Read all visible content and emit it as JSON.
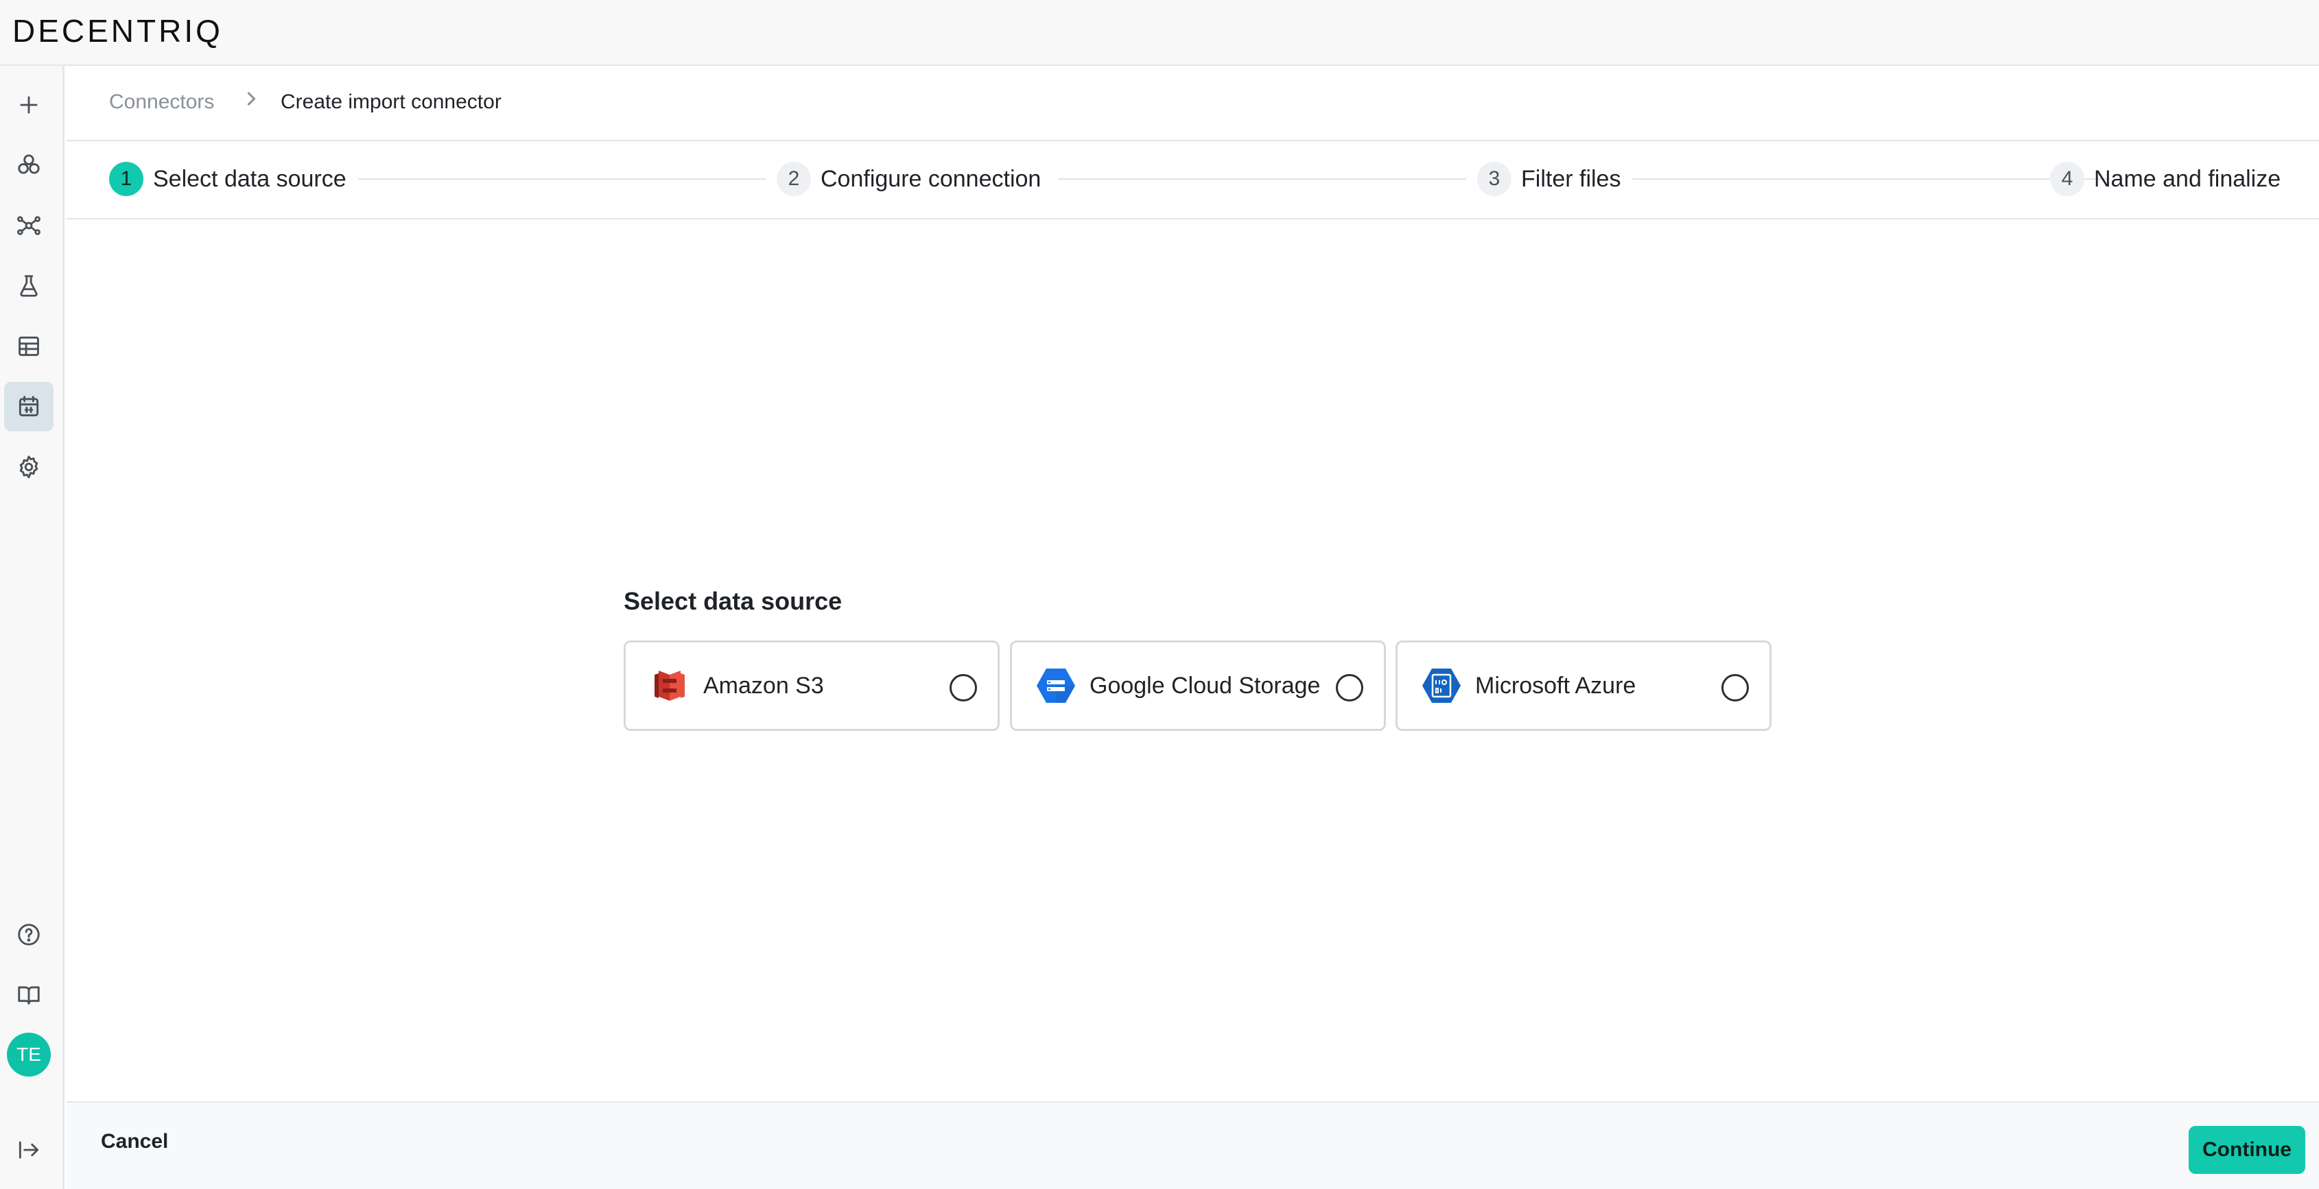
{
  "app": {
    "logo": "DECENTRIQ"
  },
  "sidebar": {
    "items": [
      {
        "name": "plus-icon"
      },
      {
        "name": "datarooms-icon"
      },
      {
        "name": "network-icon"
      },
      {
        "name": "flask-icon"
      },
      {
        "name": "table-icon"
      },
      {
        "name": "connector-icon",
        "active": true
      },
      {
        "name": "gear-icon"
      }
    ],
    "bottom": [
      {
        "name": "help-icon"
      },
      {
        "name": "book-icon"
      }
    ],
    "avatar_initials": "TE",
    "collapse_icon": "collapse-sidebar-icon"
  },
  "breadcrumb": {
    "root": "Connectors",
    "current": "Create import connector"
  },
  "stepper": {
    "steps": [
      {
        "number": "1",
        "label": "Select data source",
        "active": true
      },
      {
        "number": "2",
        "label": "Configure connection"
      },
      {
        "number": "3",
        "label": "Filter files"
      },
      {
        "number": "4",
        "label": "Name and finalize"
      }
    ]
  },
  "main": {
    "title": "Select data source",
    "options": [
      {
        "label": "Amazon S3",
        "icon": "amazon-s3-icon"
      },
      {
        "label": "Google Cloud Storage",
        "icon": "google-cloud-storage-icon"
      },
      {
        "label": "Microsoft Azure",
        "icon": "microsoft-azure-icon"
      }
    ]
  },
  "footer": {
    "cancel_label": "Cancel",
    "continue_label": "Continue"
  },
  "colors": {
    "accent": "#12c9ad",
    "avatar": "#0ec2a8"
  }
}
